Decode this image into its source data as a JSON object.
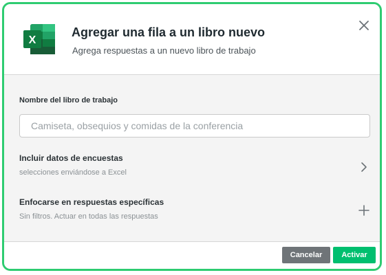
{
  "header": {
    "icon": "excel-icon",
    "icon_letter": "X",
    "title": "Agregar una fila a un libro nuevo",
    "subtitle": "Agrega respuestas a un nuevo libro de trabajo",
    "close_icon": "close-icon"
  },
  "form": {
    "workbook_label": "Nombre del libro de trabajo",
    "workbook_placeholder": "Camiseta, obsequios y comidas de la conferencia",
    "workbook_value": ""
  },
  "options": [
    {
      "title": "Incluir datos de encuestas",
      "subtitle": "selecciones enviándose a Excel",
      "icon": "chevron-right-icon"
    },
    {
      "title": "Enfocarse en respuestas específicas",
      "subtitle": "Sin filtros. Actuar en todas las respuestas",
      "icon": "plus-icon"
    }
  ],
  "footer": {
    "cancel_label": "Cancelar",
    "activate_label": "Activar"
  },
  "colors": {
    "frame_border": "#2ecc71",
    "body_background": "#f4f4f4",
    "cancel_button": "#6f7478",
    "activate_button": "#00bf6f",
    "excel_green_dark": "#107c41",
    "excel_green_light": "#33c481"
  }
}
